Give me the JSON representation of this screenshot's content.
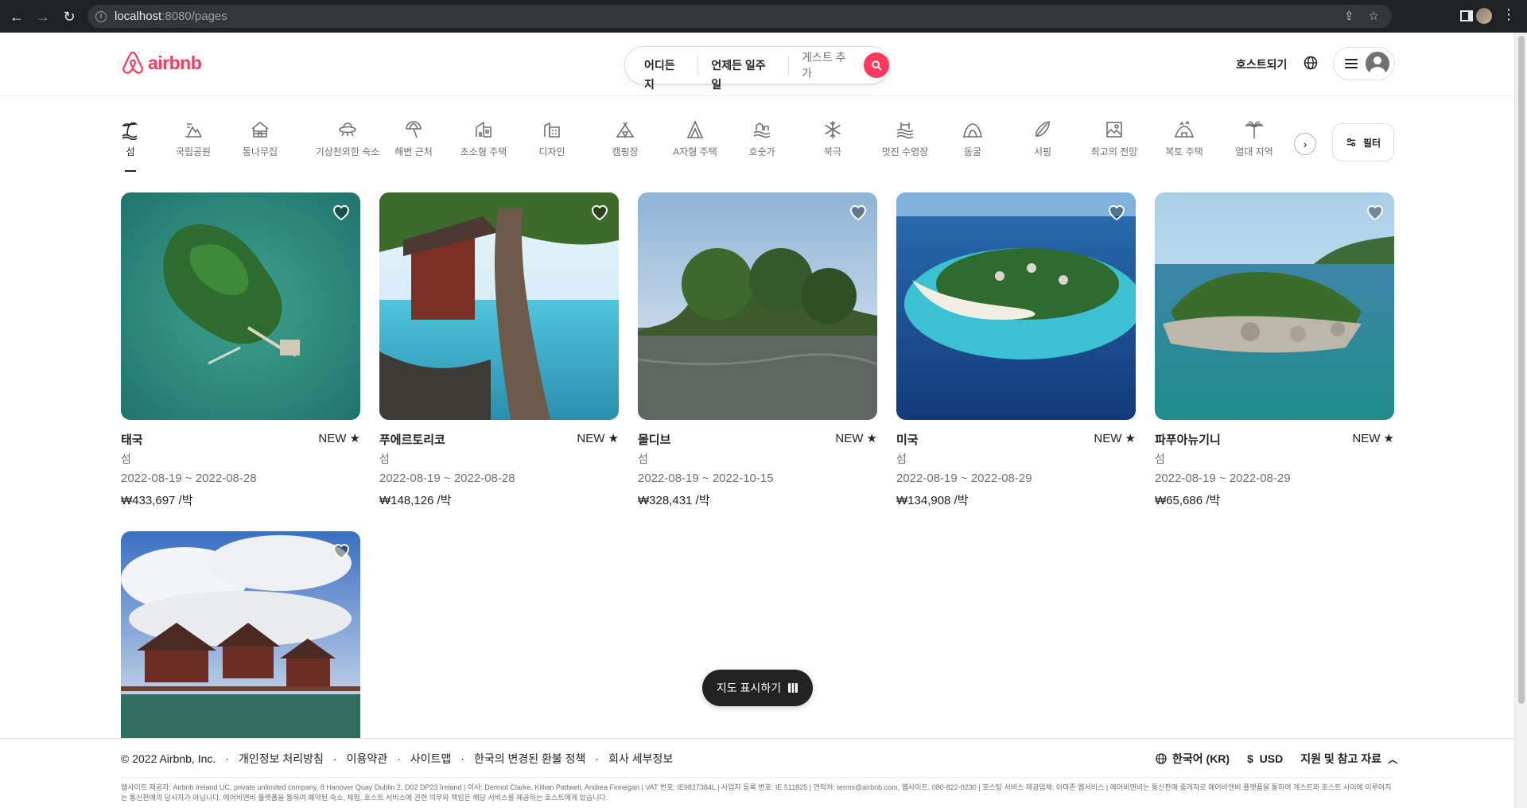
{
  "browser": {
    "url_host": "localhost",
    "url_tail": ":8080/pages"
  },
  "header": {
    "brand": "airbnb",
    "search": {
      "where": "어디든지",
      "when": "언제든 일주일",
      "guests": "게스트 추가"
    },
    "host_link": "호스트되기"
  },
  "categories": [
    {
      "label": "섬",
      "icon": "island-icon",
      "active": true
    },
    {
      "label": "국립공원",
      "icon": "national-park-icon"
    },
    {
      "label": "통나무집",
      "icon": "cabin-icon"
    },
    {
      "label": "기상천외한 숙소",
      "icon": "ufo-icon"
    },
    {
      "label": "해변 근처",
      "icon": "beach-umbrella-icon"
    },
    {
      "label": "초소형 주택",
      "icon": "tiny-home-icon"
    },
    {
      "label": "디자인",
      "icon": "design-building-icon"
    },
    {
      "label": "캠핑장",
      "icon": "camping-icon"
    },
    {
      "label": "A자형 주택",
      "icon": "a-frame-icon"
    },
    {
      "label": "호숫가",
      "icon": "lake-icon"
    },
    {
      "label": "북극",
      "icon": "snowflake-icon"
    },
    {
      "label": "멋진 수영장",
      "icon": "pool-icon"
    },
    {
      "label": "동굴",
      "icon": "cave-icon"
    },
    {
      "label": "서핑",
      "icon": "surf-icon"
    },
    {
      "label": "최고의 전망",
      "icon": "view-icon"
    },
    {
      "label": "복토 주택",
      "icon": "earth-home-icon"
    },
    {
      "label": "열대 지역",
      "icon": "tropical-icon"
    }
  ],
  "filter_label": "필터",
  "listings": [
    {
      "title": "태국",
      "badge": "NEW",
      "category": "섬",
      "dates": "2022-08-19 ~ 2022-08-28",
      "price": "₩433,697 /박"
    },
    {
      "title": "푸에르토리코",
      "badge": "NEW",
      "category": "섬",
      "dates": "2022-08-19 ~ 2022-08-28",
      "price": "₩148,126 /박"
    },
    {
      "title": "몰디브",
      "badge": "NEW",
      "category": "섬",
      "dates": "2022-08-19 ~ 2022-10-15",
      "price": "₩328,431 /박"
    },
    {
      "title": "미국",
      "badge": "NEW",
      "category": "섬",
      "dates": "2022-08-19 ~ 2022-08-29",
      "price": "₩134,908 /박"
    },
    {
      "title": "파푸아뉴기니",
      "badge": "NEW",
      "category": "섬",
      "dates": "2022-08-19 ~ 2022-08-29",
      "price": "₩65,686 /박"
    }
  ],
  "map_button": "지도 표시하기",
  "footer": {
    "copyright": "© 2022 Airbnb, Inc.",
    "links": [
      "개인정보 처리방침",
      "이용약관",
      "사이트맵",
      "한국의 변경된 환불 정책",
      "회사 세부정보"
    ],
    "language": "한국어 (KR)",
    "currency_symbol": "$",
    "currency": "USD",
    "support": "지원 및 참고 자료",
    "legal": "웹사이트 제공자: Airbnb Ireland UC, private unlimited company, 8 Hanover Quay Dublin 2, D02 DP23 Ireland | 이사: Dermot Clarke, Killian Pattwell, Andrea Finnegan | VAT 번호: IE9827384L | 사업자 등록 번호: IE 511825 | 연락처: terms@airbnb.com, 웹사이트, 080-822-0230 | 호스팅 서비스 제공업체: 아마존 웹서비스 | 에어비앤비는 통신판매 중개자로 에어비앤비 플랫폼을 통하여 게스트와 호스트 사이에 이루어지는 통신판매의 당사자가 아닙니다. 에어비앤비 플랫폼을 통하여 예약된 숙소, 체험, 호스트 서비스에 관한 의무와 책임은 해당 서비스를 제공하는 호스트에게 있습니다."
  },
  "colors": {
    "brand": "#ff385c",
    "text": "#222222",
    "muted": "#717171"
  }
}
